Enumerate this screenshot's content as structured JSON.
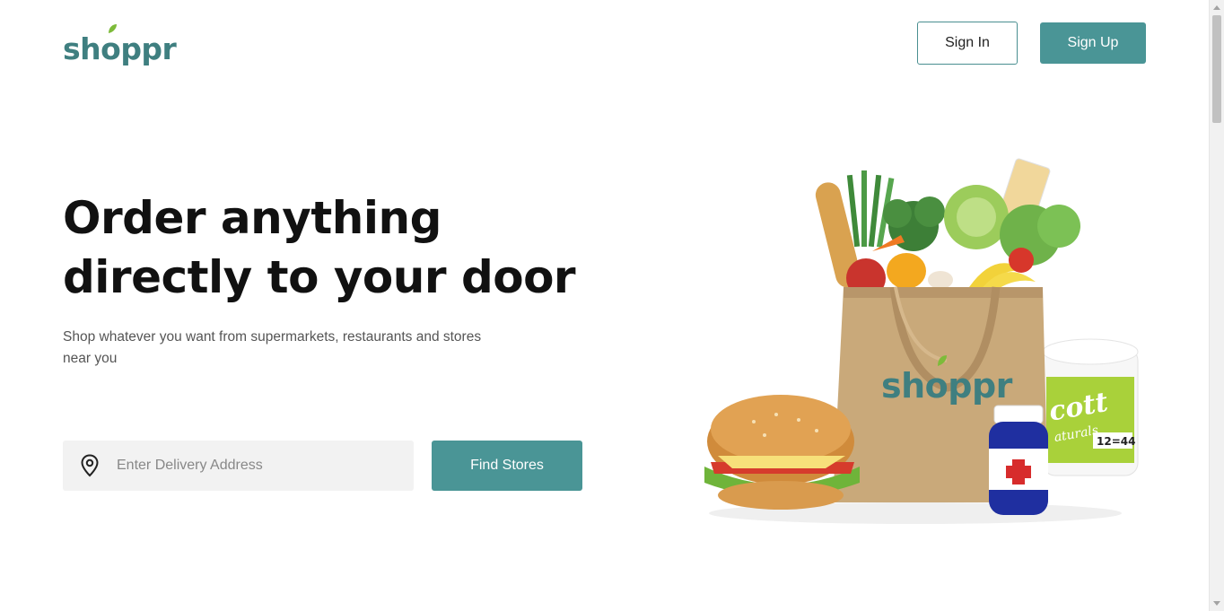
{
  "header": {
    "logo_text_start": "sh",
    "logo_text_o": "o",
    "logo_text_end": "ppr",
    "sign_in_label": "Sign In",
    "sign_up_label": "Sign Up"
  },
  "hero": {
    "headline_line1": "Order anything",
    "headline_line2": "directly to your door",
    "subtext": "Shop whatever you want from supermarkets, restaurants and stores near you",
    "address_placeholder": "Enter Delivery Address",
    "find_stores_label": "Find Stores"
  },
  "illustration": {
    "bag_brand": "shoppr",
    "paper_towel_brand": "Scott Naturals",
    "paper_towel_count": "12=44"
  },
  "icons": {
    "logo_leaf": "leaf-icon",
    "address_pin": "map-pin-icon"
  },
  "colors": {
    "brand_teal": "#4a9596",
    "logo_teal": "#3f7f80",
    "leaf_green": "#7dbb3a",
    "headline": "#111111",
    "input_bg": "#f2f2f2"
  }
}
